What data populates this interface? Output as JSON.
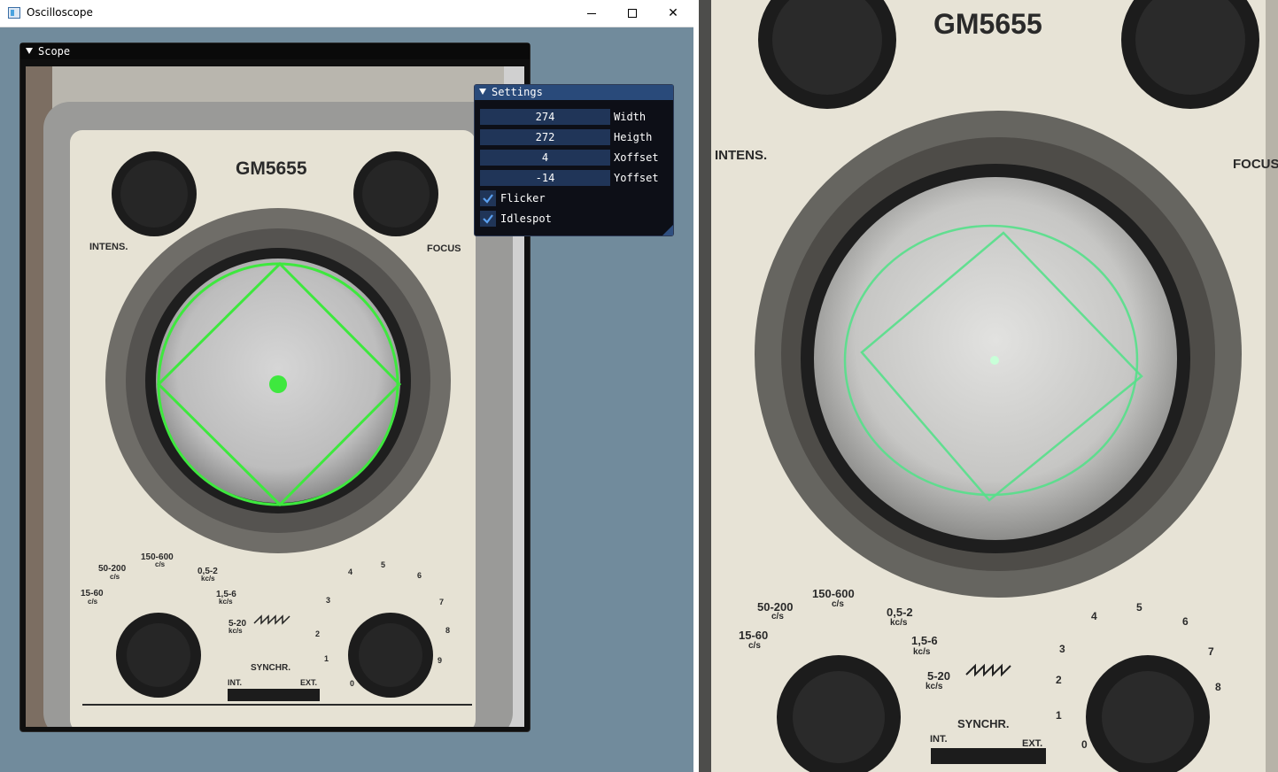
{
  "window": {
    "title": "Oscilloscope"
  },
  "scope_panel": {
    "title": "Scope"
  },
  "device": {
    "brand": "GM5655",
    "left_knob": "INTENS.",
    "right_knob": "FOCUS",
    "sync_label": "SYNCHR.",
    "int_label": "INT.",
    "ext_label": "EXT.",
    "range_labels": [
      "15-60",
      "c/s",
      "50-200",
      "c/s",
      "150-600",
      "c/s",
      "0,5-2",
      "kc/s",
      "1,5-6",
      "kc/s",
      "5-20",
      "kc/s"
    ],
    "dial_numbers": [
      "0",
      "1",
      "2",
      "3",
      "4",
      "5",
      "6",
      "7",
      "8",
      "9"
    ]
  },
  "settings": {
    "title": "Settings",
    "fields": [
      {
        "label": "Width",
        "value": "274"
      },
      {
        "label": "Heigth",
        "value": "272"
      },
      {
        "label": "Xoffset",
        "value": "4"
      },
      {
        "label": "Yoffset",
        "value": "-14"
      }
    ],
    "checkboxes": [
      {
        "label": "Flicker",
        "checked": true
      },
      {
        "label": "Idlespot",
        "checked": true
      }
    ]
  },
  "colors": {
    "background": "#718b9c",
    "trace": "#3ee83e",
    "panel_title": "#294a7a",
    "field_bg": "#203558"
  }
}
